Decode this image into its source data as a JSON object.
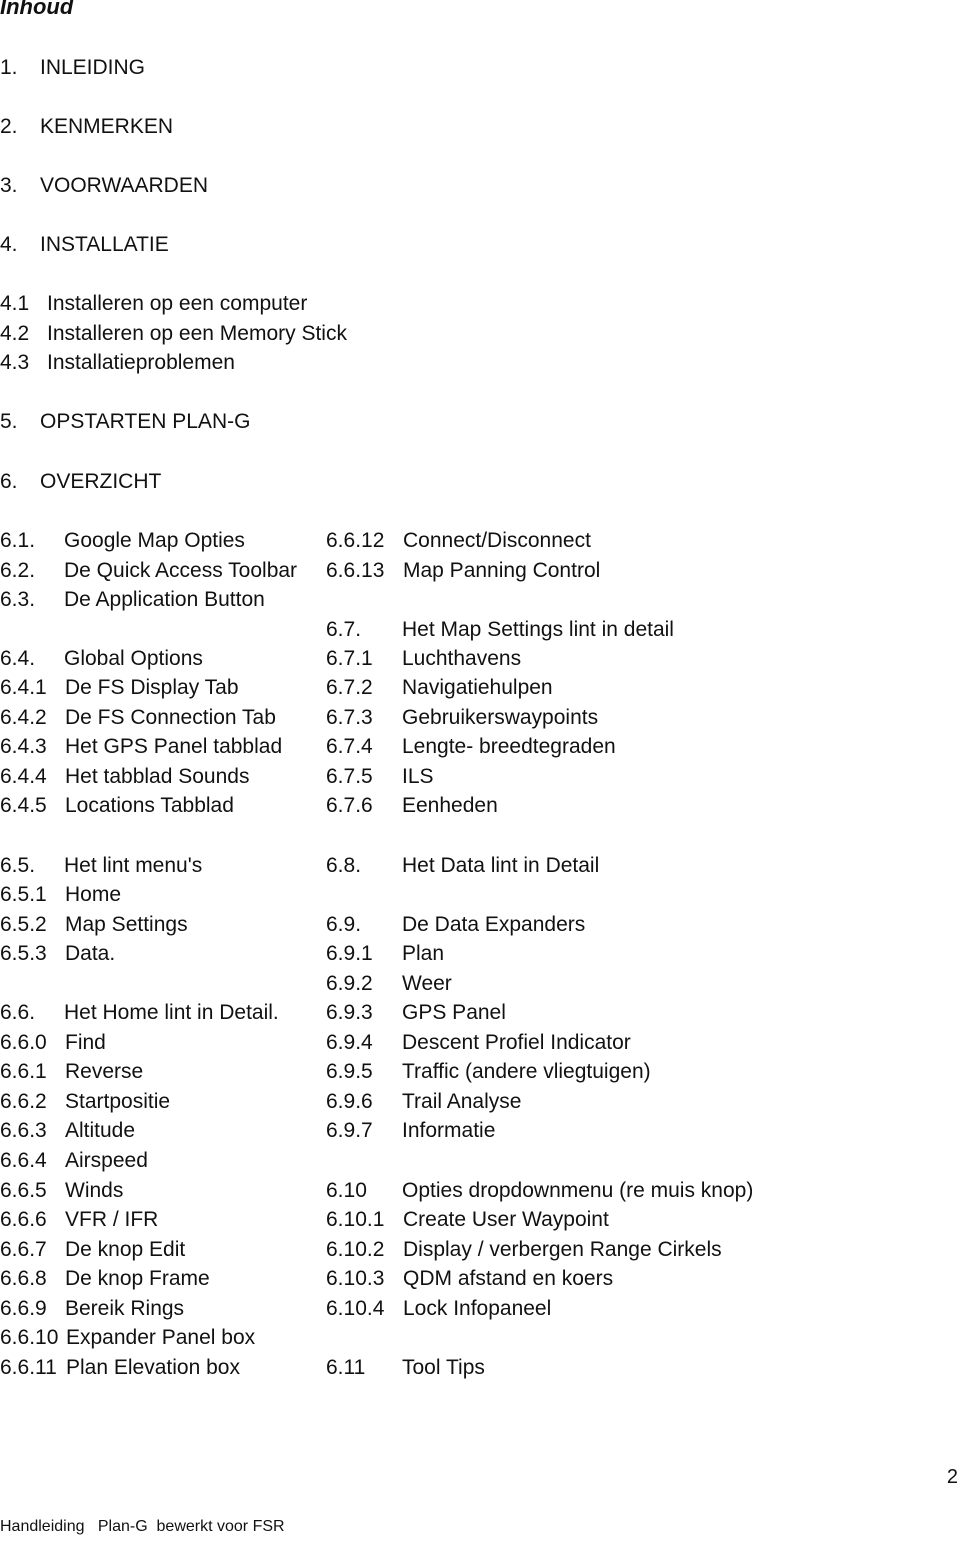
{
  "title": "Inhoud",
  "main_sections": [
    {
      "num": "1.",
      "label": "INLEIDING"
    },
    {
      "num": "2.",
      "label": "KENMERKEN"
    },
    {
      "num": "3.",
      "label": "VOORWAARDEN"
    },
    {
      "num": "4.",
      "label": "INSTALLATIE"
    }
  ],
  "installatie_sub": [
    {
      "num": "4.1",
      "label": "Installeren op een computer"
    },
    {
      "num": "4.2",
      "label": "Installeren op een Memory Stick"
    },
    {
      "num": "4.3",
      "label": "Installatieproblemen"
    }
  ],
  "section5": {
    "num": "5.",
    "label": "OPSTARTEN PLAN-G"
  },
  "section6": {
    "num": "6.",
    "label": "OVERZICHT"
  },
  "left_column": [
    {
      "num": "6.1.",
      "label": "Google Map Opties"
    },
    {
      "num": "6.2.",
      "label": "De Quick Access Toolbar"
    },
    {
      "num": "6.3.",
      "label": "De Application Button"
    },
    {
      "num": "6.4.",
      "label": "Global Options"
    },
    {
      "num": "6.4.1",
      "label": "De FS Display Tab"
    },
    {
      "num": "6.4.2",
      "label": "De FS Connection Tab"
    },
    {
      "num": "6.4.3",
      "label": "Het GPS Panel tabblad"
    },
    {
      "num": "6.4.4",
      "label": "Het tabblad Sounds"
    },
    {
      "num": "6.4.5",
      "label": "Locations Tabblad"
    },
    {
      "num": "6.5.",
      "label": "Het lint menu's"
    },
    {
      "num": "6.5.1",
      "label": "Home"
    },
    {
      "num": "6.5.2",
      "label": "Map Settings"
    },
    {
      "num": "6.5.3",
      "label": "Data."
    },
    {
      "num": "6.6.",
      "label": "Het Home lint in Detail."
    },
    {
      "num": "6.6.0",
      "label": "Find"
    },
    {
      "num": "6.6.1",
      "label": "Reverse"
    },
    {
      "num": "6.6.2",
      "label": "Startpositie"
    },
    {
      "num": "6.6.3",
      "label": "Altitude"
    },
    {
      "num": "6.6.4",
      "label": "Airspeed"
    },
    {
      "num": "6.6.5",
      "label": "Winds"
    },
    {
      "num": "6.6.6",
      "label": "VFR / IFR"
    },
    {
      "num": "6.6.7",
      "label": "De knop Edit"
    },
    {
      "num": "6.6.8",
      "label": "De knop Frame"
    },
    {
      "num": "6.6.9",
      "label": "Bereik Rings"
    },
    {
      "num": "6.6.10",
      "label": "Expander Panel box"
    },
    {
      "num": "6.6.11",
      "label": "Plan Elevation box"
    }
  ],
  "right_column": [
    {
      "num": "6.6.12",
      "label": "Connect/Disconnect"
    },
    {
      "num": "6.6.13",
      "label": "Map Panning Control"
    },
    {
      "num": "6.7.",
      "label": "Het Map Settings lint in detail"
    },
    {
      "num": "6.7.1",
      "label": "Luchthavens"
    },
    {
      "num": "6.7.2",
      "label": "Navigatiehulpen"
    },
    {
      "num": "6.7.3",
      "label": "Gebruikerswaypoints"
    },
    {
      "num": "6.7.4",
      "label": "Lengte- breedtegraden"
    },
    {
      "num": "6.7.5",
      "label": "ILS"
    },
    {
      "num": "6.7.6",
      "label": "Eenheden"
    },
    {
      "num": "6.8.",
      "label": "Het Data lint in Detail"
    },
    {
      "num": "6.9.",
      "label": "De Data Expanders"
    },
    {
      "num": "6.9.1",
      "label": "Plan"
    },
    {
      "num": "6.9.2",
      "label": "Weer"
    },
    {
      "num": "6.9.3",
      "label": "GPS Panel"
    },
    {
      "num": "6.9.4",
      "label": "Descent Profiel Indicator"
    },
    {
      "num": "6.9.5",
      "label": "Traffic (andere vliegtuigen)"
    },
    {
      "num": "6.9.6",
      "label": "Trail Analyse"
    },
    {
      "num": "6.9.7",
      "label": "Informatie"
    },
    {
      "num": "6.10",
      "label": "Opties dropdownmenu (re muis knop)"
    },
    {
      "num": "6.10.1",
      "label": "Create User Waypoint"
    },
    {
      "num": "6.10.2",
      "label": "Display / verbergen Range Cirkels"
    },
    {
      "num": "6.10.3",
      "label": "QDM afstand en koers"
    },
    {
      "num": "6.10.4",
      "label": "Lock Infopaneel"
    },
    {
      "num": "6.11",
      "label": "Tool Tips"
    }
  ],
  "footer": {
    "text": "Handleiding   Plan-G  bewerkt voor FSR",
    "page_number": "2"
  }
}
